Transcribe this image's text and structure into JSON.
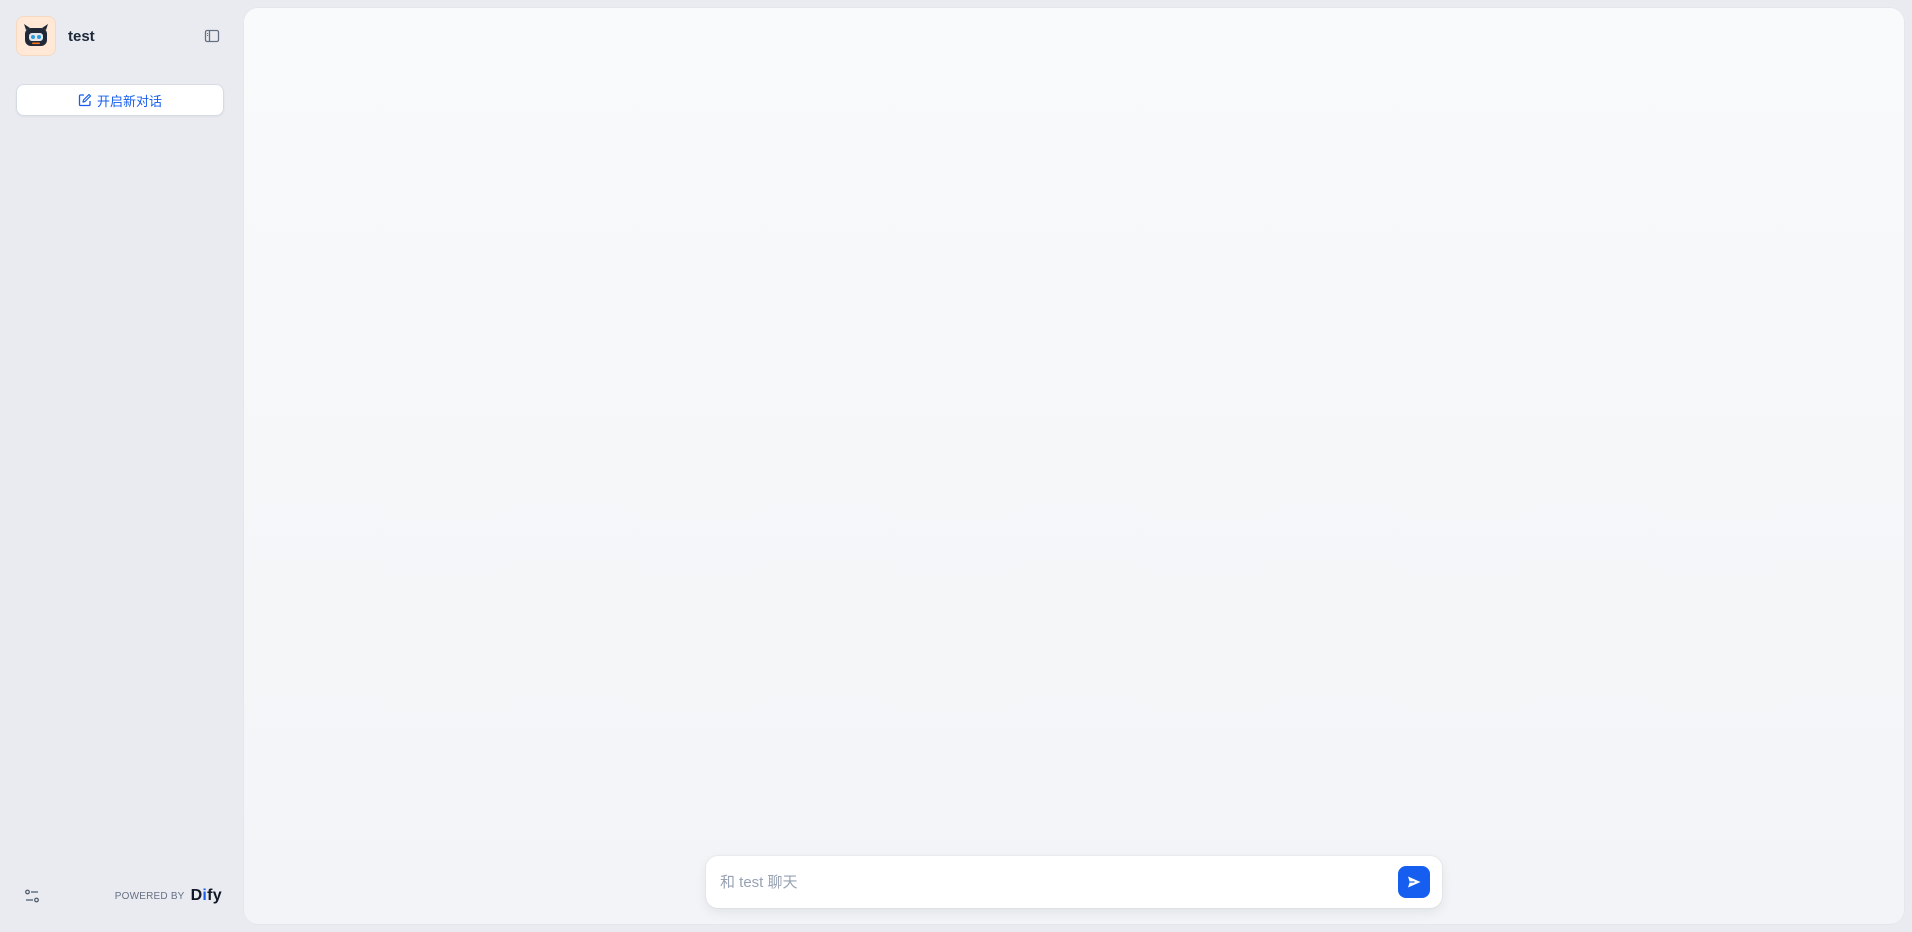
{
  "app": {
    "name": "test",
    "accent_color": "#155eef"
  },
  "sidebar": {
    "new_chat_label": "开启新对话",
    "powered_by_label": "POWERED BY",
    "brand_prefix": "D",
    "brand_accent": "i",
    "brand_suffix": "fy"
  },
  "chat": {
    "input_placeholder": "和 test 聊天"
  },
  "icons": {
    "avatar": "robot-icon",
    "collapse": "sidebar-collapse-icon",
    "new_chat": "edit-icon",
    "settings": "sliders-icon",
    "send": "send-icon"
  }
}
